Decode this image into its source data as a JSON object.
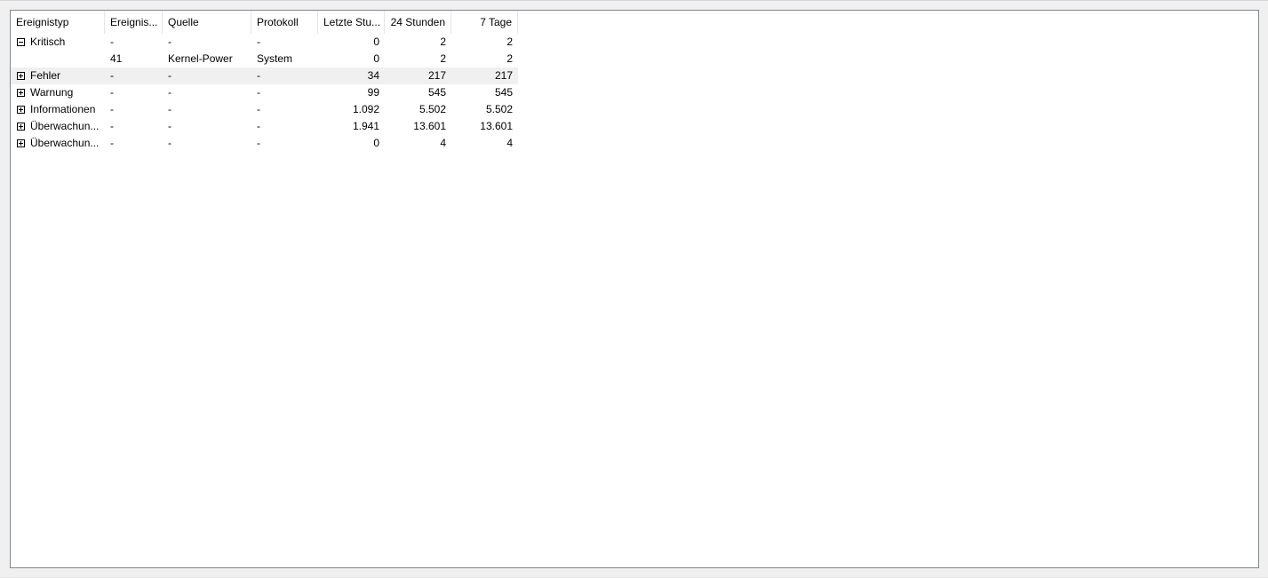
{
  "table": {
    "columns": [
      "Ereignistyp",
      "Ereignis...",
      "Quelle",
      "Protokoll",
      "Letzte Stu...",
      "24 Stunden",
      "7 Tage"
    ],
    "rows": [
      {
        "type": "Kritisch",
        "event_id": "-",
        "source": "-",
        "log": "-",
        "last_hour": "0",
        "hours_24": "2",
        "days_7": "2",
        "state": "expanded",
        "toggle_icon": "minus-box-icon"
      },
      {
        "type": "",
        "event_id": "41",
        "source": "Kernel-Power",
        "log": "System",
        "last_hour": "0",
        "hours_24": "2",
        "days_7": "2",
        "state": "child"
      },
      {
        "type": "Fehler",
        "event_id": "-",
        "source": "-",
        "log": "-",
        "last_hour": "34",
        "hours_24": "217",
        "days_7": "217",
        "state": "collapsed",
        "toggle_icon": "plus-box-icon"
      },
      {
        "type": "Warnung",
        "event_id": "-",
        "source": "-",
        "log": "-",
        "last_hour": "99",
        "hours_24": "545",
        "days_7": "545",
        "state": "collapsed",
        "toggle_icon": "plus-box-icon"
      },
      {
        "type": "Informationen",
        "event_id": "-",
        "source": "-",
        "log": "-",
        "last_hour": "1.092",
        "hours_24": "5.502",
        "days_7": "5.502",
        "state": "collapsed",
        "toggle_icon": "plus-box-icon"
      },
      {
        "type": "Überwachun...",
        "event_id": "-",
        "source": "-",
        "log": "-",
        "last_hour": "1.941",
        "hours_24": "13.601",
        "days_7": "13.601",
        "state": "collapsed",
        "toggle_icon": "plus-box-icon"
      },
      {
        "type": "Überwachun...",
        "event_id": "-",
        "source": "-",
        "log": "-",
        "last_hour": "0",
        "hours_24": "4",
        "days_7": "4",
        "state": "collapsed",
        "toggle_icon": "plus-box-icon"
      }
    ]
  },
  "colors": {
    "panel_border": "#828790",
    "hover_row": "#f0f0f0",
    "background": "#f0f0f0"
  }
}
